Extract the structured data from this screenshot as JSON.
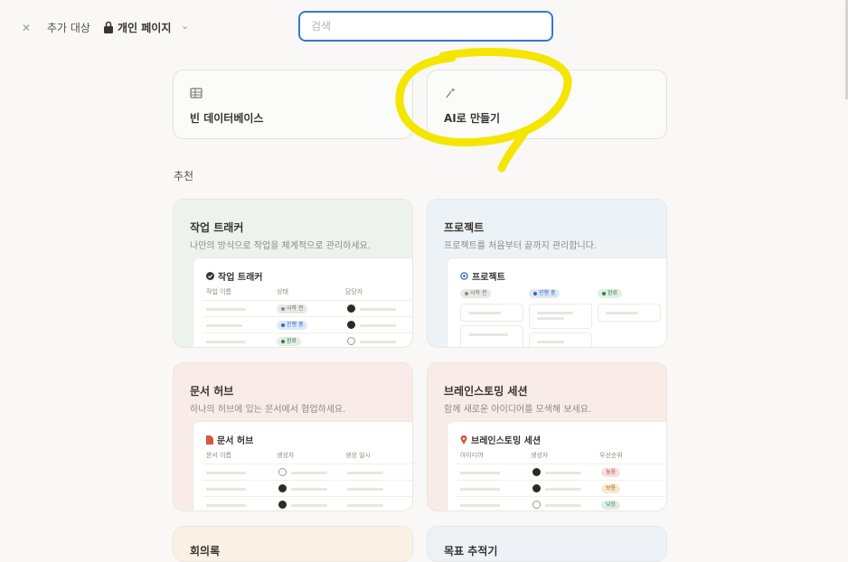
{
  "topbar": {
    "add_to_label": "추가 대상",
    "page_name": "개인 페이지",
    "search_placeholder": "검색"
  },
  "top_cards": [
    {
      "label": "빈 데이터베이스",
      "icon": "table-icon"
    },
    {
      "label": "AI로 만들기",
      "icon": "ai-sparkle-icon"
    }
  ],
  "section_title": "추천",
  "templates": {
    "task_tracker": {
      "title": "작업 트래커",
      "desc": "나만의 방식으로 작업을 체계적으로 관리하세요.",
      "preview_title": "작업 트래커",
      "headers": [
        "작업 이름",
        "상태",
        "담당자"
      ],
      "statuses": [
        "시작 전",
        "진행 중",
        "완료"
      ],
      "bg": "#eef2ee"
    },
    "project": {
      "title": "프로젝트",
      "desc": "프로젝트를 처음부터 끝까지 관리합니다.",
      "preview_title": "프로젝트",
      "statuses": [
        "시작 전",
        "진행 중",
        "완료"
      ],
      "bg": "#edf2f7"
    },
    "doc_hub": {
      "title": "문서 허브",
      "desc": "하나의 허브에 있는 문서에서 협업하세요.",
      "preview_title": "문서 허브",
      "headers": [
        "문서 이름",
        "생성자",
        "생성 일시"
      ],
      "bg": "#f9ece8"
    },
    "brainstorm": {
      "title": "브레인스토밍 세션",
      "desc": "함께 새로운 아이디어를 모색해 보세요.",
      "preview_title": "브레인스토밍 세션",
      "headers": [
        "아이디어",
        "생성자",
        "우선순위"
      ],
      "priorities": [
        "높음",
        "보통",
        "낮음"
      ],
      "bg": "#f9ece8"
    }
  },
  "bottom_cards": [
    {
      "title": "회의록",
      "bg": "#fbf0e4"
    },
    {
      "title": "목표 추적기",
      "bg": "#edf2f7"
    }
  ],
  "colors": {
    "accent": "#2f7ad9",
    "annotation": "#f4e600"
  }
}
